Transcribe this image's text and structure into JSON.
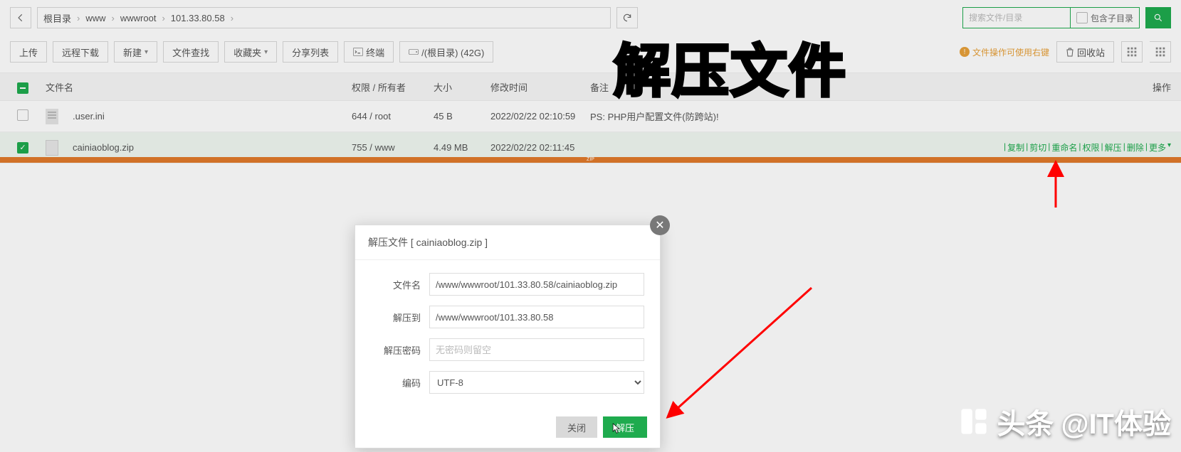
{
  "breadcrumb": {
    "root": "根目录",
    "p1": "www",
    "p2": "wwwroot",
    "p3": "101.33.80.58"
  },
  "search": {
    "placeholder": "搜索文件/目录",
    "subdir": "包含子目录"
  },
  "toolbar": {
    "upload": "上传",
    "remote": "远程下载",
    "new": "新建",
    "find": "文件查找",
    "fav": "收藏夹",
    "share": "分享列表",
    "term": "终端",
    "root": "/(根目录) (42G)",
    "hint": "文件操作可使用右键",
    "trash": "回收站"
  },
  "thead": {
    "name": "文件名",
    "perm": "权限 / 所有者",
    "size": "大小",
    "mtime": "修改时间",
    "note": "备注",
    "ops": "操作"
  },
  "rows": [
    {
      "name": ".user.ini",
      "perm": "644 / root",
      "size": "45 B",
      "mtime": "2022/02/22 02:10:59",
      "note": "PS: PHP用户配置文件(防跨站)!"
    },
    {
      "name": "cainiaoblog.zip",
      "perm": "755 / www",
      "size": "4.49 MB",
      "mtime": "2022/02/22 02:11:45",
      "note": ""
    }
  ],
  "rowact": {
    "copy": "复制",
    "cut": "剪切",
    "rename": "重命名",
    "perm": "权限",
    "unzip": "解压",
    "del": "删除",
    "more": "更多"
  },
  "overlay_title": "解压文件",
  "modal": {
    "title": "解压文件 [ cainiaoblog.zip ]",
    "l_name": "文件名",
    "v_name": "/www/wwwroot/101.33.80.58/cainiaoblog.zip",
    "l_to": "解压到",
    "v_to": "/www/wwwroot/101.33.80.58",
    "l_pw": "解压密码",
    "ph_pw": "无密码则留空",
    "l_enc": "编码",
    "v_enc": "UTF-8",
    "close": "关闭",
    "ok": "解压"
  },
  "watermark": {
    "a": "头条",
    "b": "@IT体验"
  }
}
